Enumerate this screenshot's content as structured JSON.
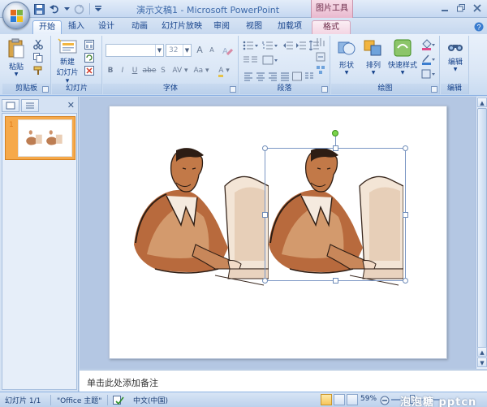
{
  "window": {
    "title": "演示文稿1 - Microsoft PowerPoint",
    "context_tool": "图片工具"
  },
  "tabs": [
    {
      "label": "开始",
      "active": true
    },
    {
      "label": "插入"
    },
    {
      "label": "设计"
    },
    {
      "label": "动画"
    },
    {
      "label": "幻灯片放映"
    },
    {
      "label": "审阅"
    },
    {
      "label": "视图"
    },
    {
      "label": "加载项"
    },
    {
      "label": "格式",
      "context": true
    }
  ],
  "ribbon": {
    "clipboard": {
      "label": "剪贴板",
      "paste": "粘贴"
    },
    "slides": {
      "label": "幻灯片",
      "new_slide_line1": "新建",
      "new_slide_line2": "幻灯片"
    },
    "font": {
      "label": "字体",
      "font_name": "",
      "font_size": "32",
      "bold": "B",
      "italic": "I",
      "underline": "U",
      "strike": "abe",
      "shadow": "S",
      "spacing": "AV",
      "case": "Aa",
      "color": "A",
      "grow": "A",
      "shrink": "A"
    },
    "paragraph": {
      "label": "段落"
    },
    "drawing": {
      "label": "绘图",
      "shapes": "形状",
      "arrange": "排列",
      "quick_styles": "快速样式"
    },
    "editing": {
      "label": "编辑",
      "edit": "编辑"
    }
  },
  "left_pane": {
    "slide_number": "1"
  },
  "notes": {
    "placeholder": "单击此处添加备注"
  },
  "status": {
    "slide_info": "幻灯片 1/1",
    "theme": "\"Office 主题\"",
    "language": "中文(中国)",
    "zoom": "59%",
    "watermark": "泡泡糖 pptcn"
  },
  "colors": {
    "accent": "#15428b",
    "context_tab": "#e9b9cf",
    "thumb_border": "#f6a94a"
  }
}
